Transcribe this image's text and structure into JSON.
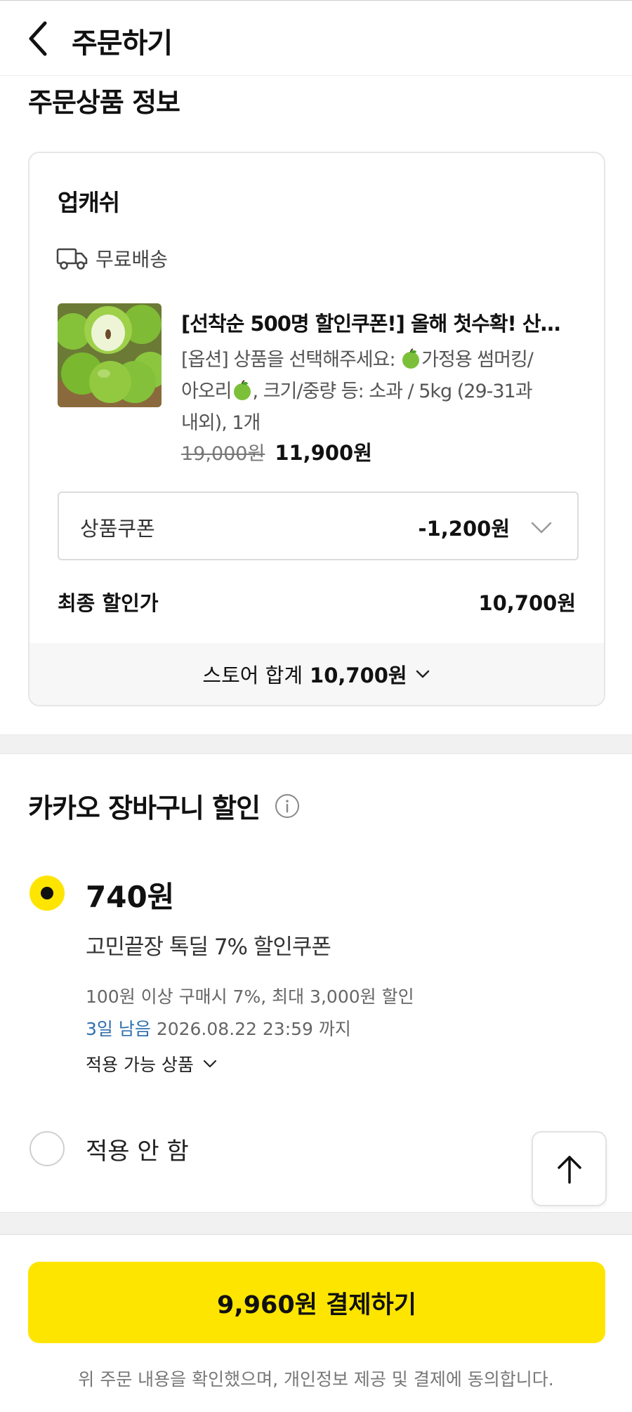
{
  "header": {
    "title": "주문하기",
    "back_icon": "chevron-left-icon"
  },
  "order_section": {
    "title": "주문상품 정보"
  },
  "store": {
    "name": "업캐쉬",
    "shipping_label": "무료배송",
    "shipping_icon": "truck-icon",
    "product": {
      "title": "[선착순 500명 할인쿠폰!] 올해 첫수확! 산…",
      "option_line1_a": "[옵션] 상품을 선택해주세요: ",
      "option_line1_b": "가정용 썸머킹/",
      "option_line2_a": "아오리",
      "option_line2_b": ", 크기/중량 등: 소과 / 5kg (29-31과",
      "option_line3": "내외), 1개",
      "original_price": "19,000원",
      "sale_price": "11,900원"
    },
    "coupon": {
      "label": "상품쿠폰",
      "value": "-1,200원"
    },
    "final": {
      "label": "최종 할인가",
      "value": "10,700원"
    },
    "total": {
      "label": "스토어 합계",
      "value": "10,700원"
    }
  },
  "kakao_discount": {
    "title": "카카오 장바구니 할인",
    "option_selected": {
      "amount": "740원",
      "coupon_name": "고민끝장 톡딜 7% 할인쿠폰",
      "condition": "100원 이상 구매시 7%, 최대 3,000원 할인",
      "remaining": "3일 남음",
      "expiry": "2026.08.22 23:59 까지",
      "applicable_label": "적용 가능 상품"
    },
    "option_none": {
      "label": "적용 안 함"
    }
  },
  "footer": {
    "pay_button": "9,960원 결제하기",
    "agreement": "위 주문 내용을 확인했으며, 개인정보 제공 및 결제에 동의합니다."
  },
  "colors": {
    "accent": "#fee500",
    "link_blue": "#2f6fae"
  }
}
